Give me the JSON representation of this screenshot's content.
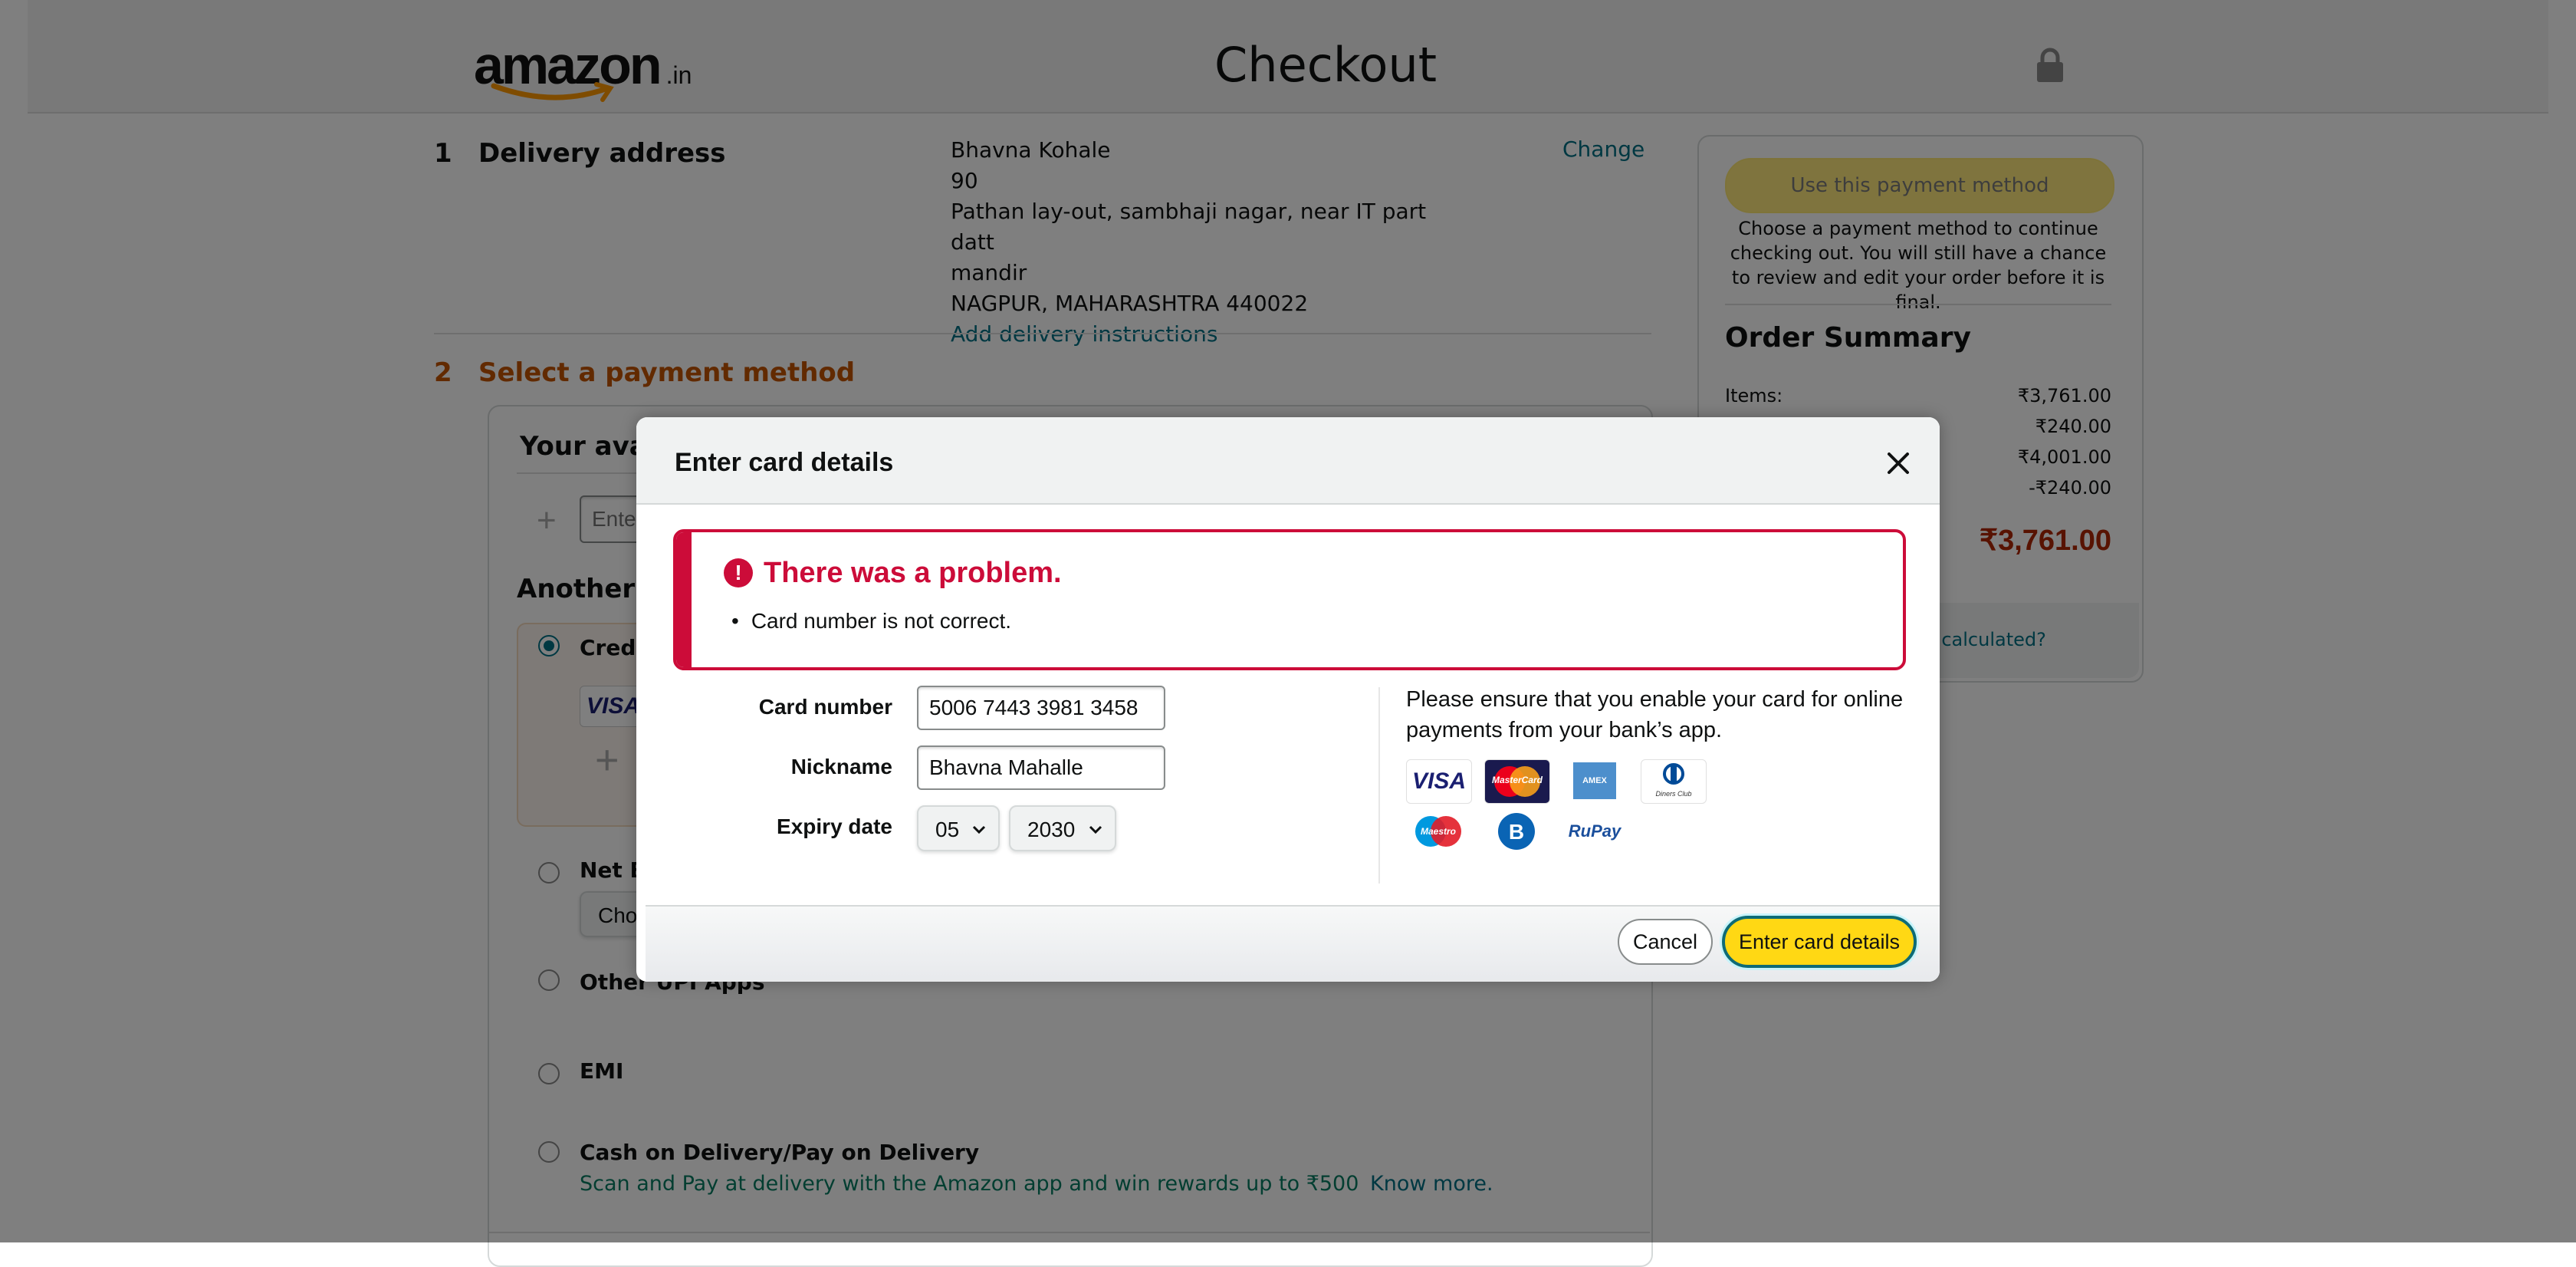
{
  "header": {
    "logo_text": "amazon",
    "logo_suffix": ".in",
    "title": "Checkout",
    "lock_icon": "lock-icon"
  },
  "delivery": {
    "step": "1",
    "title": "Delivery address",
    "name": "Bhavna Kohale",
    "line1": "90",
    "line2": "Pathan lay-out, sambhaji nagar, near IT part datt",
    "line3": "mandir",
    "line4": "NAGPUR, MAHARASHTRA 440022",
    "add_instructions": "Add delivery instructions",
    "change": "Change"
  },
  "payment": {
    "step": "2",
    "title": "Select a payment method",
    "available_heading": "Your available balance",
    "code_placeholder": "Enter Code",
    "another_heading": "Another payment method",
    "credit_label": "Credit or debit card",
    "netbanking_label": "Net Banking",
    "netbanking_select": "Choose an Option",
    "upi_label": "Other UPI Apps",
    "emi_label": "EMI",
    "cod_label": "Cash on Delivery/Pay on Delivery",
    "cod_note": "Scan and Pay at delivery with the Amazon app and win rewards up to ₹500",
    "cod_link": "Know more."
  },
  "summary": {
    "use_button": "Use this payment method",
    "note": "Choose a payment method to continue checking out. You will still have a chance to review and edit your order before it is final.",
    "title": "Order Summary",
    "items_label": "Items:",
    "items_value": "₹3,761.00",
    "row2_value": "₹240.00",
    "row3_value": "₹4,001.00",
    "row4_value": "-₹240.00",
    "total_value": "₹3,761.00",
    "calc_link": "How are delivery costs calculated?"
  },
  "modal": {
    "title": "Enter card details",
    "close_icon": "close-icon",
    "alert_title": "There was a problem.",
    "alert_item": "Card number is not correct.",
    "card_number_label": "Card number",
    "card_number_value": "5006 7443 3981 3458",
    "nickname_label": "Nickname",
    "nickname_value": "Bhavna Mahalle",
    "expiry_label": "Expiry date",
    "expiry_month": "05",
    "expiry_year": "2030",
    "note": "Please ensure that you enable your card for online payments from your bank’s app.",
    "card_brands": [
      "VISA",
      "MasterCard",
      "AMEX",
      "Diners Club",
      "Maestro",
      "Bajaj",
      "RuPay"
    ],
    "cancel": "Cancel",
    "submit": "Enter card details",
    "colors": {
      "accent": "#ffd814",
      "error": "#cc0c39",
      "link": "#007185"
    }
  }
}
